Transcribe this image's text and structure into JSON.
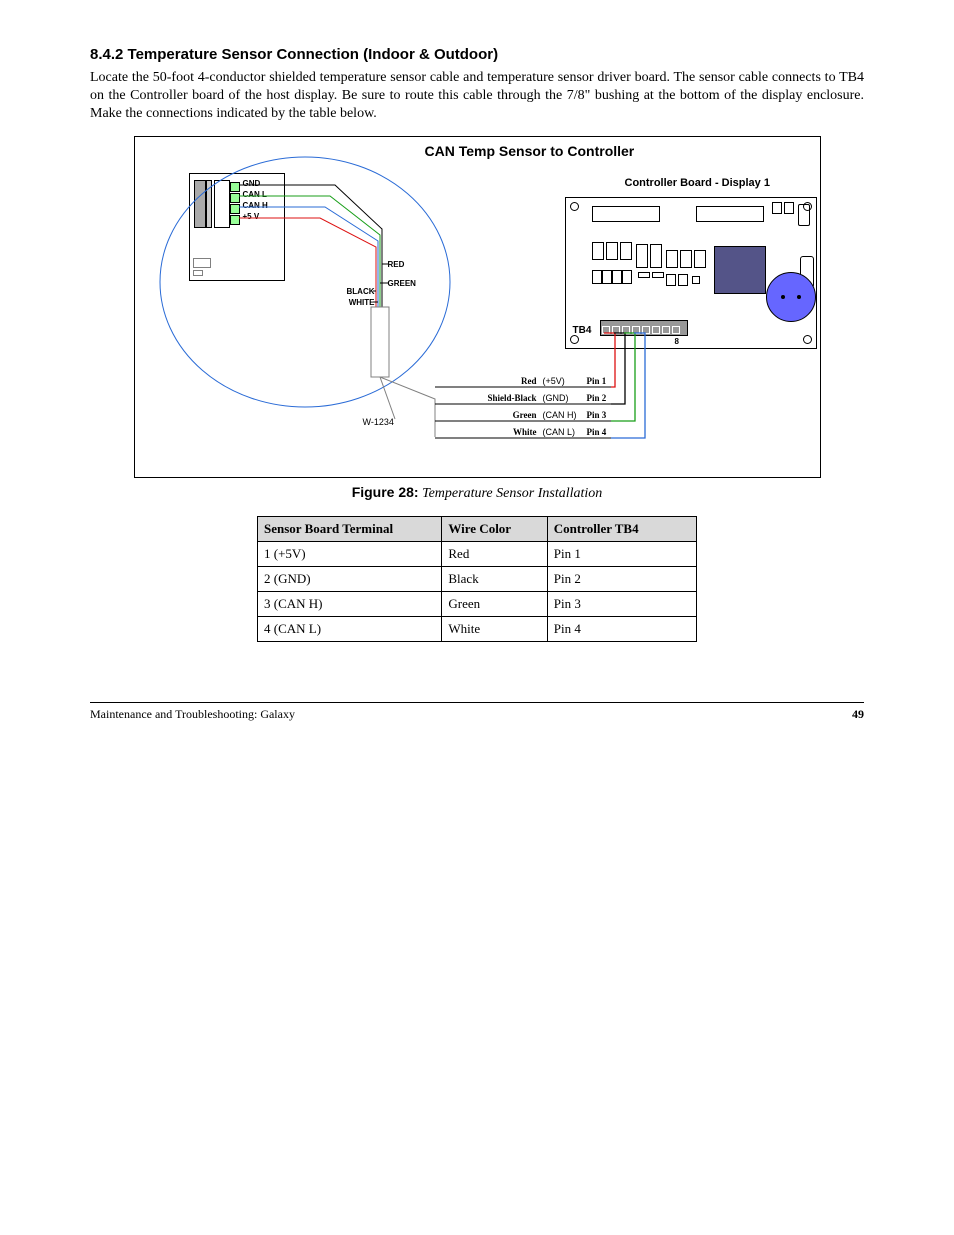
{
  "section": {
    "title": "8.4.2 Temperature Sensor Connection (Indoor & Outdoor)",
    "para": "Locate the 50-foot 4-conductor shielded temperature sensor cable and temperature sensor driver board. The sensor cable connects to TB4 on the Controller board of the host display. Be sure to route this cable through the 7/8\" bushing at the bottom of the display enclosure. Make the connections indicated by the table below."
  },
  "figure": {
    "wcable": "W-1234",
    "title": "CAN Temp Sensor to Controller",
    "controller_title": "Controller Board - Display 1",
    "sensor_pins": [
      "GND",
      "CAN L",
      "CAN H",
      "+5 V"
    ],
    "sensor_wire_colors": [
      "RED",
      "GREEN",
      "BLACK",
      "WHITE"
    ],
    "tb4_label": "TB4",
    "tb4_pin8": "8",
    "wires": [
      {
        "color": "Red",
        "signal": "(+5V)",
        "pin": "Pin 1"
      },
      {
        "color": "Shield-Black",
        "signal": "(GND)",
        "pin": "Pin 2"
      },
      {
        "color": "Green",
        "signal": "(CAN H)",
        "pin": "Pin 3"
      },
      {
        "color": "White",
        "signal": "(CAN L)",
        "pin": "Pin 4"
      }
    ],
    "caption_ref": "Figure 28:",
    "caption_text": "Temperature Sensor Installation"
  },
  "table": {
    "headers": [
      "Sensor Board Terminal",
      "Wire Color",
      "Controller TB4"
    ],
    "rows": [
      [
        "1 (+5V)",
        "Red",
        "Pin 1"
      ],
      [
        "2 (GND)",
        "Black",
        "Pin 2"
      ],
      [
        "3 (CAN H)",
        "Green",
        "Pin 3"
      ],
      [
        "4 (CAN L)",
        "White",
        "Pin 4"
      ]
    ]
  },
  "footer": {
    "left": "Maintenance and Troubleshooting: Galaxy",
    "right": "49"
  }
}
